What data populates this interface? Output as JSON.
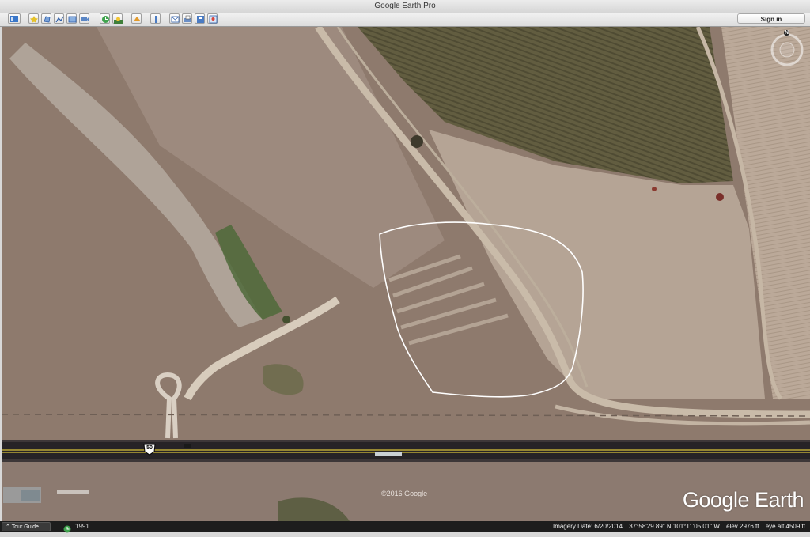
{
  "window": {
    "title": "Google Earth Pro"
  },
  "toolbar": {
    "buttons": [
      "sidebar-toggle",
      "add-placemark",
      "add-polygon",
      "add-path",
      "add-image-overlay",
      "record-tour",
      "historical-imagery",
      "sunlight",
      "switch-planets",
      "ruler",
      "email",
      "print",
      "save-image",
      "view-in-google-maps"
    ],
    "sign_in_label": "Sign in"
  },
  "map": {
    "highway_shield": "50",
    "copyright": "©2016 Google",
    "logo": "Google Earth",
    "compass_label": "N"
  },
  "statusbar": {
    "tour_guide_label": "Tour Guide",
    "historical_year": "1991",
    "imagery_date": "Imagery Date: 6/20/2014",
    "coordinates": "37°58'29.89\" N  101°11'05.01\" W",
    "elevation": "elev  2976 ft",
    "eye_alt": "eye alt   4509 ft"
  },
  "colors": {
    "terrain": "#8f7b6f",
    "field_dark": "#5f5a3e",
    "field_light": "#b9a898",
    "road": "#262326",
    "road_line": "#d8c23a",
    "outline": "#ffffff"
  }
}
